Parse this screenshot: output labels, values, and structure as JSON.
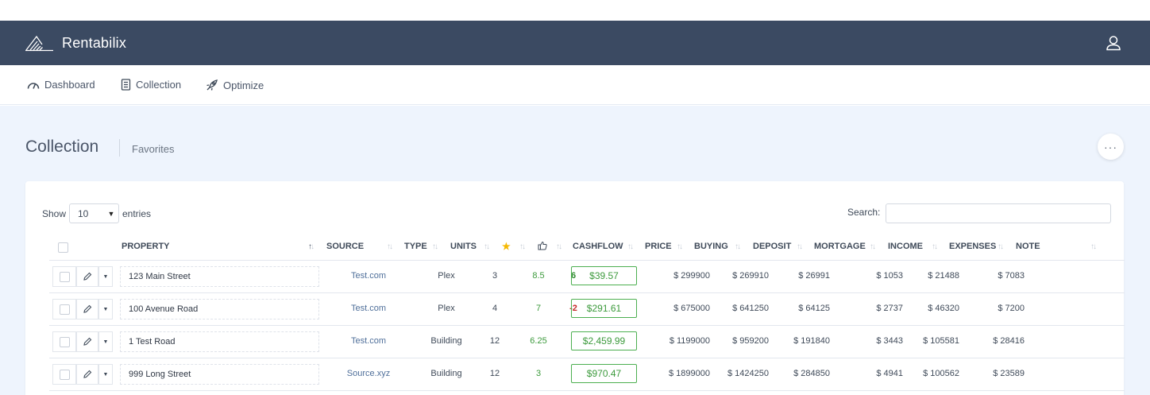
{
  "app": {
    "name": "Rentabilix"
  },
  "nav": [
    {
      "label": "Dashboard",
      "icon": "speedometer-icon"
    },
    {
      "label": "Collection",
      "icon": "document-icon"
    },
    {
      "label": "Optimize",
      "icon": "rocket-icon"
    }
  ],
  "page": {
    "title": "Collection",
    "subtitle": "Favorites"
  },
  "table_controls": {
    "show_label": "Show",
    "entries_value": "10",
    "entries_label": "entries",
    "search_label": "Search:",
    "search_value": ""
  },
  "columns": {
    "property": "PROPERTY",
    "source": "SOURCE",
    "type": "TYPE",
    "units": "UNITS",
    "rating_icon": "star-icon",
    "vote_icon": "thumbs-up-icon",
    "cashflow": "CASHFLOW",
    "price": "PRICE",
    "buying": "BUYING",
    "deposit": "DEPOSIT",
    "mortgage": "MORTGAGE",
    "income": "INCOME",
    "expenses": "EXPENSES",
    "note": "NOTE"
  },
  "colors": {
    "header_bg": "#3b4a62",
    "content_bg": "#eef4fd",
    "cashflow_green": "#4caf50",
    "negative_red": "#c62828",
    "star_yellow": "#f5b800"
  },
  "rows": [
    {
      "property": "123 Main Street",
      "source": "Test.com",
      "type": "Plex",
      "units": "3",
      "rating": "8.5",
      "vote": "6",
      "cashflow": "$39.57",
      "price": "$ 299900",
      "buying": "$ 269910",
      "deposit": "$ 26991",
      "mortgage": "$ 1053",
      "income": "$ 21488",
      "expenses": "$ 7083",
      "note": ""
    },
    {
      "property": "100 Avenue Road",
      "source": "Test.com",
      "type": "Plex",
      "units": "4",
      "rating": "7",
      "vote": "-2",
      "cashflow": "$291.61",
      "price": "$ 675000",
      "buying": "$ 641250",
      "deposit": "$ 64125",
      "mortgage": "$ 2737",
      "income": "$ 46320",
      "expenses": "$ 7200",
      "note": ""
    },
    {
      "property": "1 Test Road",
      "source": "Test.com",
      "type": "Building",
      "units": "12",
      "rating": "6.25",
      "vote": "",
      "cashflow": "$2,459.99",
      "price": "$ 1199000",
      "buying": "$ 959200",
      "deposit": "$ 191840",
      "mortgage": "$ 3443",
      "income": "$ 105581",
      "expenses": "$ 28416",
      "note": ""
    },
    {
      "property": "999 Long Street",
      "source": "Source.xyz",
      "type": "Building",
      "units": "12",
      "rating": "3",
      "vote": "",
      "cashflow": "$970.47",
      "price": "$ 1899000",
      "buying": "$ 1424250",
      "deposit": "$ 284850",
      "mortgage": "$ 4941",
      "income": "$ 100562",
      "expenses": "$ 23589",
      "note": ""
    }
  ]
}
